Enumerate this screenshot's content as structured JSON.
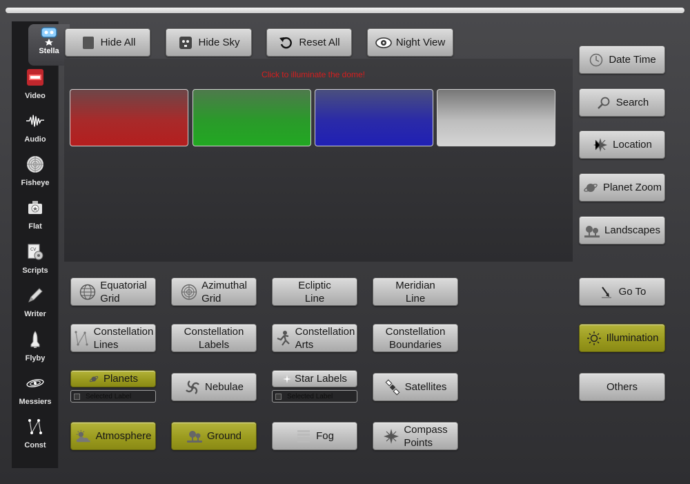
{
  "sidebar": {
    "items": [
      {
        "label": "Stella",
        "icon": "stella-icon",
        "active": true
      },
      {
        "label": "Video",
        "icon": "video-icon"
      },
      {
        "label": "Audio",
        "icon": "audio-waveform-icon"
      },
      {
        "label": "Fisheye",
        "icon": "fisheye-icon"
      },
      {
        "label": "Flat",
        "icon": "flat-projector-icon"
      },
      {
        "label": "Scripts",
        "icon": "scripts-icon"
      },
      {
        "label": "Writer",
        "icon": "pen-icon"
      },
      {
        "label": "Flyby",
        "icon": "shuttle-icon"
      },
      {
        "label": "Messiers",
        "icon": "galaxy-icon"
      },
      {
        "label": "Const",
        "icon": "constellation-icon"
      }
    ]
  },
  "toolbar": {
    "hide_all": "Hide All",
    "hide_sky": "Hide Sky",
    "reset_all": "Reset All",
    "night_view": "Night View"
  },
  "illumination": {
    "title": "Click to illuminate the dome!",
    "swatches": [
      "red",
      "green",
      "blue",
      "white"
    ]
  },
  "right_panel": {
    "date_time": "Date Time",
    "search": "Search",
    "location": "Location",
    "planet_zoom": "Planet Zoom",
    "landscapes": "Landscapes",
    "go_to": "Go To",
    "illumination": "Illumination",
    "others": "Others"
  },
  "grid": {
    "equatorial": [
      "Equatorial",
      "Grid"
    ],
    "azimuthal": [
      "Azimuthal",
      "Grid"
    ],
    "ecliptic": [
      "Ecliptic",
      "Line"
    ],
    "meridian": [
      "Meridian",
      "Line"
    ],
    "const_lines": [
      "Constellation",
      "Lines"
    ],
    "const_labels": [
      "Constellation",
      "Labels"
    ],
    "const_arts": [
      "Constellation",
      "Arts"
    ],
    "const_boundaries": [
      "Constellation",
      "Boundaries"
    ],
    "planets": "Planets",
    "planets_sub": "Selected Label",
    "nebulae": "Nebulae",
    "star_labels": "Star Labels",
    "star_labels_sub": "Selected Label",
    "satellites": "Satellites",
    "atmosphere": "Atmosphere",
    "ground": "Ground",
    "fog": "Fog",
    "compass": [
      "Compass",
      "Points"
    ]
  },
  "colors": {
    "active_toggle": "#9b9b1f",
    "title_red": "#d81e1e"
  }
}
